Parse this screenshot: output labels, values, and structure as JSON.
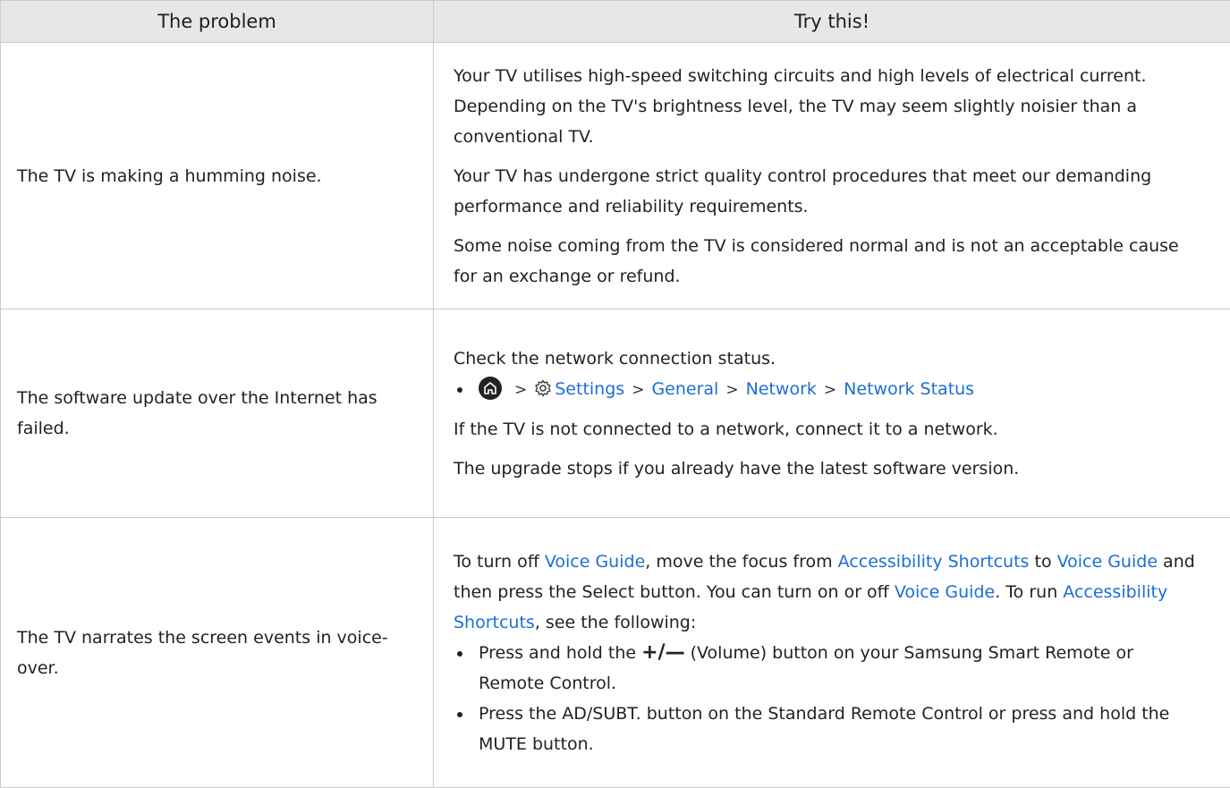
{
  "header": {
    "col1": "The problem",
    "col2": "Try this!"
  },
  "rows": [
    {
      "problem": "The TV is making a humming noise.",
      "solutions": [
        "Your TV utilises high-speed switching circuits and high levels of electrical current. Depending on the TV's brightness level, the TV may seem slightly noisier than a conventional TV.",
        "Your TV has undergone strict quality control procedures that meet our demanding performance and reliability requirements.",
        "Some noise coming from the TV is considered normal and is not an acceptable cause for an exchange or refund."
      ]
    },
    {
      "problem": "The software update over the Internet has failed.",
      "intro": "Check the network connection status.",
      "path": [
        "Settings",
        "General",
        "Network",
        "Network Status"
      ],
      "after": [
        "If the TV is not connected to a network, connect it to a network.",
        "The upgrade stops if you already have the latest software version."
      ]
    },
    {
      "problem": "The TV narrates the screen events in voice-over.",
      "para": {
        "t1": "To turn off ",
        "l1": "Voice Guide",
        "t2": ", move the focus from ",
        "l2": "Accessibility Shortcuts",
        "t3": " to ",
        "l3": "Voice Guide",
        "t4": " and then press the Select button. You can turn on or off ",
        "l4": "Voice Guide",
        "t5": ". To run ",
        "l5": "Accessibility Shortcuts",
        "t6": ", see the following:"
      },
      "bullets": [
        {
          "pre": "Press and hold the ",
          "sym": "+/—",
          "post": " (Volume) button on your Samsung Smart Remote or Remote Control."
        },
        {
          "text": "Press the AD/SUBT. button on the Standard Remote Control or press and hold the MUTE button."
        }
      ]
    }
  ],
  "colors": {
    "link": "#1a6fd6",
    "header_bg": "#e7e7e7",
    "border": "#cccccc"
  }
}
